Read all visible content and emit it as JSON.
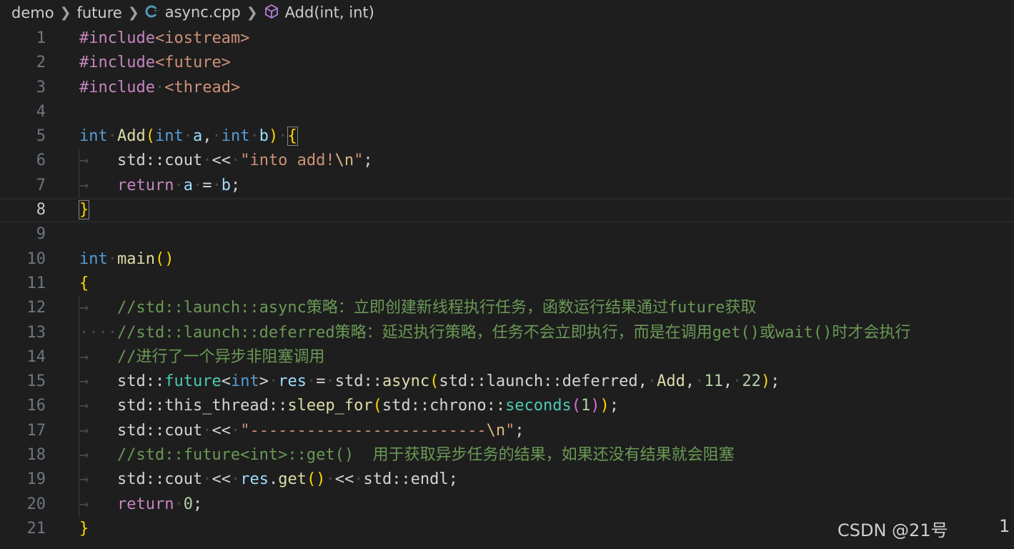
{
  "breadcrumb": {
    "items": [
      {
        "label": "demo"
      },
      {
        "label": "future"
      },
      {
        "label": "async.cpp",
        "icon": "cpp-file-icon"
      },
      {
        "label": "Add(int, int)",
        "icon": "method-cube-icon"
      }
    ],
    "separator": ">"
  },
  "editor": {
    "language": "cpp",
    "active_line": 8,
    "lines": [
      "#include<iostream>",
      "#include<future>",
      "#include <thread>",
      "",
      "int Add(int a, int b) {",
      "\tstd::cout << \"into add!\\n\";",
      "\treturn a = b;",
      "}",
      "",
      "int main()",
      "{",
      "\t//std::launch::async策略：立即创建新线程执行任务，函数运行结果通过future获取",
      "    //std::launch::deferred策略：延迟执行策略，任务不会立即执行，而是在调用get()或wait()时才会执行",
      "\t//进行了一个异步非阻塞调用",
      "\tstd::future<int> res = std::async(std::launch::deferred, Add, 11, 22);",
      "\tstd::this_thread::sleep_for(std::chrono::seconds(1));",
      "\tstd::cout << \"-------------------------\\n\";",
      "\t//std::future<int>::get()  用于获取异步任务的结果，如果还没有结果就会阻塞",
      "\tstd::cout << res.get() << std::endl;",
      "\treturn 0;",
      "}"
    ]
  },
  "watermark": "CSDN @21号",
  "edge_number": "1",
  "colors": {
    "background": "#1e1e1e",
    "keyword": "#569cd6",
    "string": "#ce9178",
    "comment": "#6a9955",
    "function": "#dcdcaa",
    "type": "#4ec9b0",
    "number": "#b5cea8",
    "bracket1": "#ffd700",
    "bracket2": "#da70d6",
    "bracket3": "#179fff"
  }
}
